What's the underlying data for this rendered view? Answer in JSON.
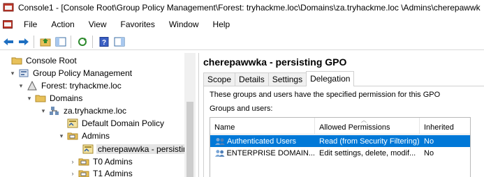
{
  "window": {
    "title": "Console1 - [Console Root\\Group Policy Management\\Forest: tryhackme.loc\\Domains\\za.tryhackme.loc \\Admins\\cherepawwk"
  },
  "menu": {
    "items": [
      "File",
      "Action",
      "View",
      "Favorites",
      "Window",
      "Help"
    ]
  },
  "toolbar": {
    "buttons": [
      "back-icon",
      "forward-icon",
      "up-folder-icon",
      "show-hide-tree-icon",
      "refresh-icon",
      "help-icon",
      "action-pane-icon"
    ]
  },
  "tree": {
    "items": [
      {
        "label": "Console Root",
        "icon": "folder-icon",
        "expander": ""
      },
      {
        "label": "Group Policy Management",
        "icon": "gpm-icon",
        "expander": "▾"
      },
      {
        "label": "Forest: tryhackme.loc",
        "icon": "forest-icon",
        "expander": "▾"
      },
      {
        "label": "Domains",
        "icon": "folder-icon",
        "expander": "▾"
      },
      {
        "label": "za.tryhackme.loc",
        "icon": "domain-icon",
        "expander": "▾"
      },
      {
        "label": "Default Domain Policy",
        "icon": "gpo-link-icon",
        "expander": ""
      },
      {
        "label": "Admins",
        "icon": "ou-icon",
        "expander": "▾"
      },
      {
        "label": "cherepawwka - persistin",
        "icon": "gpo-link-icon",
        "expander": ""
      },
      {
        "label": "T0 Admins",
        "icon": "ou-icon",
        "expander": "›"
      },
      {
        "label": "T1 Admins",
        "icon": "ou-icon",
        "expander": "›"
      }
    ]
  },
  "details": {
    "heading": "cherepawwka - persisting GPO",
    "tabs": [
      "Scope",
      "Details",
      "Settings",
      "Delegation"
    ],
    "active_tab": "Delegation",
    "description": "These groups and users have the specified permission for this GPO",
    "groups_label": "Groups and users:",
    "columns": [
      "Name",
      "Allowed Permissions",
      "Inherited"
    ],
    "rows": [
      {
        "name": "Authenticated Users",
        "permissions": "Read (from Security Filtering)",
        "inherited": "No",
        "selected": true
      },
      {
        "name": "ENTERPRISE DOMAIN...",
        "permissions": "Edit settings, delete, modif...",
        "inherited": "No",
        "selected": false
      }
    ]
  },
  "colors": {
    "selection": "#0078d7",
    "tree_selected": "#e5e5e5"
  }
}
